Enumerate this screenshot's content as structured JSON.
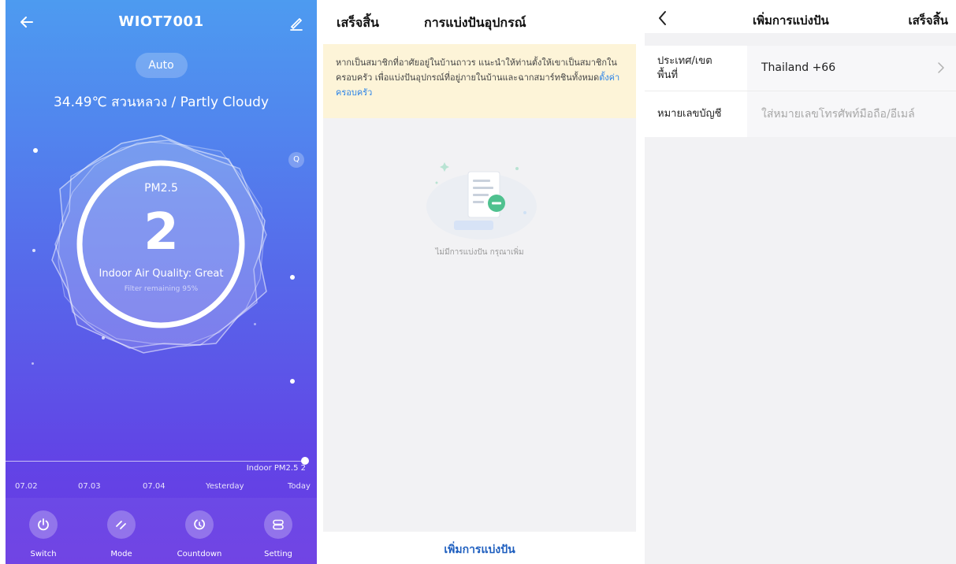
{
  "device": {
    "title": "WIOT7001",
    "mode": "Auto",
    "weather": "34.49℃ สวนหลวง / Partly Cloudy",
    "pm_label": "PM2.5",
    "pm_value": "2",
    "quality": "Indoor Air Quality: Great",
    "filter": "Filter remaining 95%",
    "refresh_icon": "Q",
    "indoor_label": "Indoor PM2.5 2",
    "timeline": [
      {
        "label": "07.02"
      },
      {
        "label": "07.03"
      },
      {
        "label": "07.04"
      },
      {
        "label": "Yesterday"
      },
      {
        "label": "Today"
      }
    ],
    "controls": [
      {
        "label": "Switch",
        "icon": "power-icon"
      },
      {
        "label": "Mode",
        "icon": "mode-icon"
      },
      {
        "label": "Countdown",
        "icon": "timer-icon"
      },
      {
        "label": "Setting",
        "icon": "settings-icon"
      }
    ],
    "colors": {
      "gradient_top": "#4d9bf0",
      "gradient_bottom": "#6a3ae3"
    }
  },
  "sharing": {
    "done_label": "เสร็จสิ้น",
    "title": "การแบ่งปันอุปกรณ์",
    "notice_text": "หากเป็นสมาชิกที่อาศัยอยู่ในบ้านถาวร แนะนำให้ท่านตั้งให้เขาเป็นสมาชิกในครอบครัว เพื่อแบ่งปันอุปกรณ์ที่อยู่ภายในบ้านและฉากสมาร์ทชินทั้งหมด",
    "notice_link": "ตั้งค่าครอบครัว",
    "empty_text": "ไม่มีการแบ่งปัน กรุณาเพิ่ม",
    "add_button": "เพิ่มการแบ่งปัน",
    "colors": {
      "notice_bg": "#fdf4d8",
      "link": "#2d84e8",
      "add_button": "#1f5fbf"
    }
  },
  "add_share": {
    "title": "เพิ่มการแบ่งปัน",
    "done_label": "เสร็จสิ้น",
    "country_label_line1": "ประเทศ/เขต",
    "country_label_line2": "พื้นที่",
    "country_value": "Thailand +66",
    "account_label": "หมายเลขบัญชี",
    "account_placeholder": "ใส่หมายเลขโทรศัพท์มือถือ/อีเมล์"
  }
}
